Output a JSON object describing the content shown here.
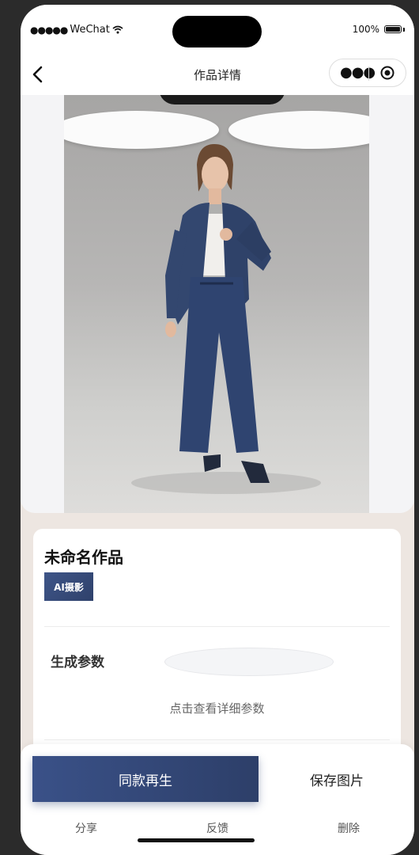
{
  "status_bar": {
    "carrier": "WeChat",
    "battery": "100%"
  },
  "nav": {
    "title": "作品详情"
  },
  "work": {
    "title": "未命名作品",
    "tag": "AI摄影"
  },
  "params": {
    "label": "生成参数",
    "link": "点击查看详细参数"
  },
  "actions": {
    "regenerate": "同款再生",
    "save": "保存图片",
    "share": "分享",
    "feedback": "反馈",
    "delete": "删除"
  },
  "colors": {
    "accent": "#344a7c",
    "page_bg": "#ede6e1"
  }
}
